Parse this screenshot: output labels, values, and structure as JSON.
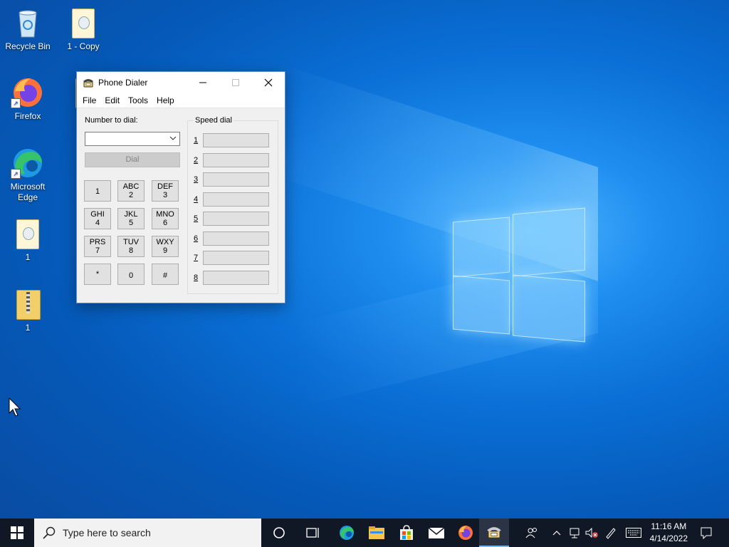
{
  "desktop": {
    "icons": [
      {
        "label": "Recycle Bin"
      },
      {
        "label": "1 - Copy"
      },
      {
        "label": "Firefox"
      },
      {
        "label": "1 -"
      },
      {
        "label": "Microsoft Edge"
      },
      {
        "label": "1"
      },
      {
        "label": "1"
      }
    ]
  },
  "window": {
    "title": "Phone Dialer",
    "menu": [
      "File",
      "Edit",
      "Tools",
      "Help"
    ],
    "number_label": "Number to dial:",
    "number_value": "",
    "dial_label": "Dial",
    "speed_dial_label": "Speed dial",
    "keys": [
      {
        "letters": "",
        "digit": "1"
      },
      {
        "letters": "ABC",
        "digit": "2"
      },
      {
        "letters": "DEF",
        "digit": "3"
      },
      {
        "letters": "GHI",
        "digit": "4"
      },
      {
        "letters": "JKL",
        "digit": "5"
      },
      {
        "letters": "MNO",
        "digit": "6"
      },
      {
        "letters": "PRS",
        "digit": "7"
      },
      {
        "letters": "TUV",
        "digit": "8"
      },
      {
        "letters": "WXY",
        "digit": "9"
      },
      {
        "letters": "",
        "digit": "*"
      },
      {
        "letters": "",
        "digit": "0"
      },
      {
        "letters": "",
        "digit": "#"
      }
    ],
    "speed_dial_numbers": [
      "1",
      "2",
      "3",
      "4",
      "5",
      "6",
      "7",
      "8"
    ]
  },
  "taskbar": {
    "search_placeholder": "Type here to search",
    "time": "11:16 AM",
    "date": "4/14/2022"
  },
  "colors": {
    "accent": "#0a6fd6",
    "taskbar": "#101826"
  }
}
